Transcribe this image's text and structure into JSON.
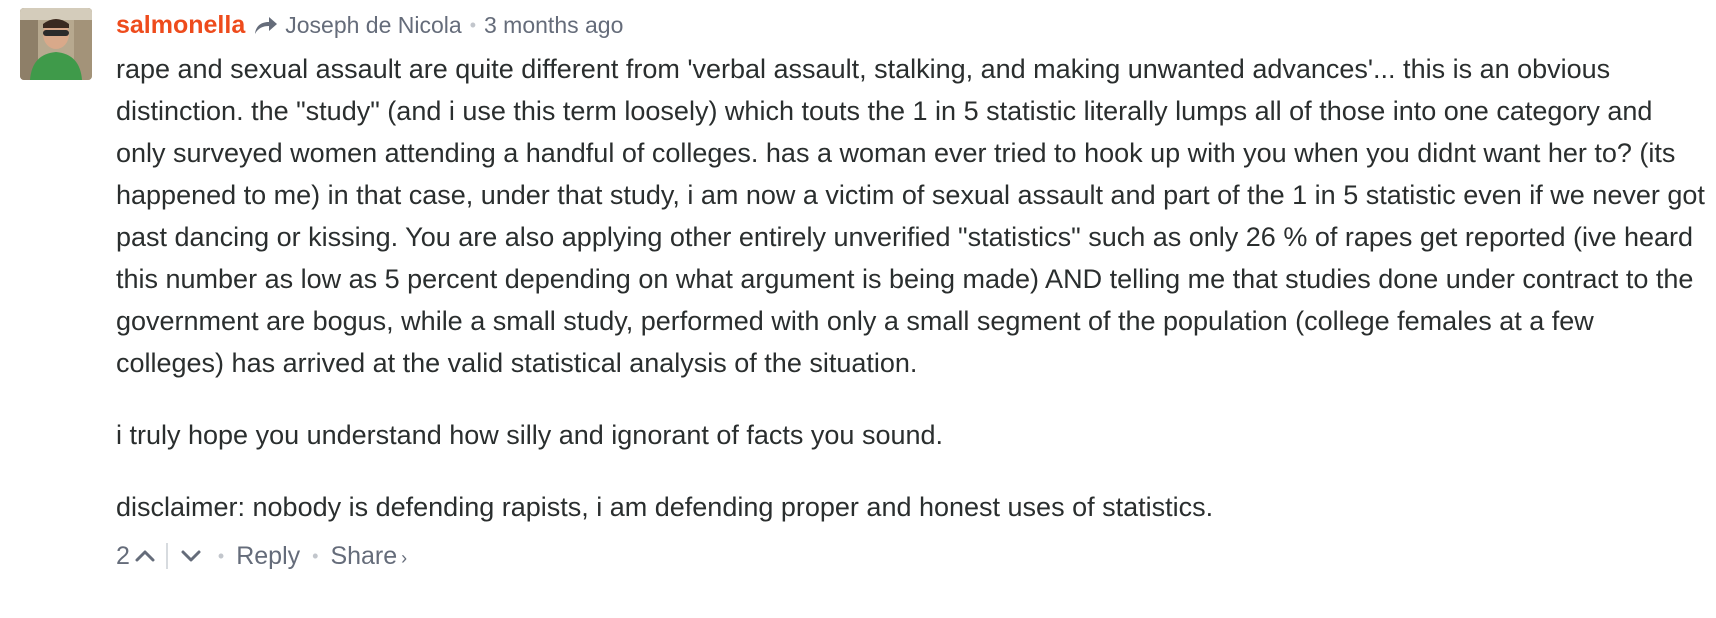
{
  "comment": {
    "author": "salmonella",
    "in_reply_to": "Joseph de Nicola",
    "separator": "•",
    "timestamp": "3 months ago",
    "paragraphs": [
      "rape and sexual assault are quite different from 'verbal assault, stalking, and making unwanted advances'... this is an obvious distinction. the \"study\" (and i use this term loosely) which touts the 1 in 5 statistic literally lumps all of those into one category and only surveyed women attending a handful of colleges. has a woman ever tried to hook up with you when you didnt want her to? (its happened to me) in that case, under that study, i am now a victim of sexual assault and part of the 1 in 5 statistic even if we never got past dancing or kissing. You are also applying other entirely unverified \"statistics\" such as only 26 % of rapes get reported (ive heard this number as low as 5 percent depending on what argument is being made) AND telling me that studies done under contract to the government are bogus, while a small study, performed with only a small segment of the population (college females at a few colleges) has arrived at the valid statistical analysis of the situation.",
      "i truly hope you understand how silly and ignorant of facts you sound.",
      "disclaimer: nobody is defending rapists, i am defending proper and honest uses of statistics."
    ],
    "footer": {
      "upvotes": "2",
      "reply_label": "Reply",
      "share_label": "Share",
      "share_chevron": "›"
    }
  },
  "colors": {
    "author": "#ee4b1c",
    "meta": "#656c7a",
    "body_text": "#2a2e2e"
  },
  "icons": {
    "reply_arrow": "share-arrow-icon",
    "upvote": "chevron-up-icon",
    "downvote": "chevron-down-icon"
  }
}
